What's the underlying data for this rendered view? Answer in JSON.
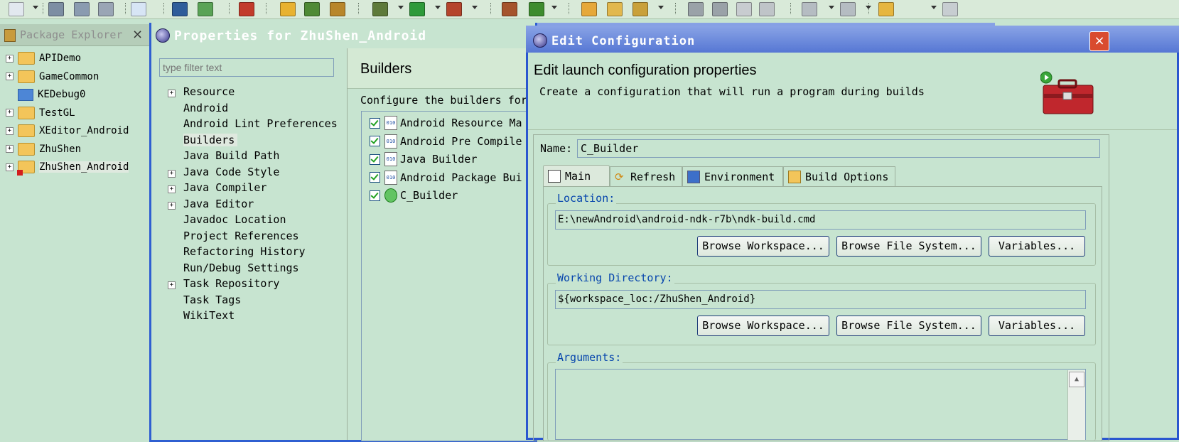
{
  "toolbar": {
    "icons": [
      "new-icon",
      "save-icon",
      "save-all-icon",
      "print-icon",
      "binary-icon",
      "download-icon",
      "android-sdk-icon",
      "task-icon",
      "open-type-icon",
      "junit-icon",
      "jar-icon",
      "debug-icon",
      "run-icon",
      "external-tools-icon",
      "build-icon",
      "refresh-icon",
      "folder-icon",
      "open-folder-icon",
      "pin-icon",
      "annotation-icon",
      "pen-icon",
      "document-icon",
      "paragraph-icon",
      "next-annotation-icon",
      "prev-annotation-icon",
      "back-icon",
      "forward-icon"
    ]
  },
  "package_explorer": {
    "title": "Package Explorer",
    "items": [
      {
        "label": "APIDemo",
        "kind": "project",
        "expandable": true
      },
      {
        "label": "GameCommon",
        "kind": "project",
        "expandable": true
      },
      {
        "label": "KEDebug0",
        "kind": "folder",
        "expandable": false
      },
      {
        "label": "TestGL",
        "kind": "project",
        "expandable": true
      },
      {
        "label": "XEditor_Android",
        "kind": "project",
        "expandable": true
      },
      {
        "label": "ZhuShen",
        "kind": "project",
        "expandable": true
      },
      {
        "label": "ZhuShen_Android",
        "kind": "project-error",
        "expandable": true
      }
    ]
  },
  "properties": {
    "title": "Properties for ZhuShen_Android",
    "filter_placeholder": "type filter text",
    "items": [
      {
        "label": "Resource",
        "expandable": true
      },
      {
        "label": "Android",
        "expandable": false
      },
      {
        "label": "Android Lint Preferences",
        "expandable": false
      },
      {
        "label": "Builders",
        "expandable": false
      },
      {
        "label": "Java Build Path",
        "expandable": false
      },
      {
        "label": "Java Code Style",
        "expandable": true
      },
      {
        "label": "Java Compiler",
        "expandable": true
      },
      {
        "label": "Java Editor",
        "expandable": true
      },
      {
        "label": "Javadoc Location",
        "expandable": false
      },
      {
        "label": "Project References",
        "expandable": false
      },
      {
        "label": "Refactoring History",
        "expandable": false
      },
      {
        "label": "Run/Debug Settings",
        "expandable": false
      },
      {
        "label": "Task Repository",
        "expandable": true
      },
      {
        "label": "Task Tags",
        "expandable": false
      },
      {
        "label": "WikiText",
        "expandable": false
      }
    ],
    "page_title": "Builders",
    "page_desc": "Configure the builders for",
    "builders": [
      {
        "label": "Android Resource Ma",
        "checked": true
      },
      {
        "label": "Android Pre Compile",
        "checked": true
      },
      {
        "label": "Java Builder",
        "checked": true
      },
      {
        "label": "Android Package Bui",
        "checked": true
      },
      {
        "label": "C_Builder",
        "checked": true
      }
    ]
  },
  "edit_config": {
    "title": "Edit Configuration",
    "close_label": "×",
    "heading": "Edit launch configuration properties",
    "subtitle": "Create a configuration that will run a program during builds",
    "name_label": "Name:",
    "name_value": "C_Builder",
    "tabs": [
      "Main",
      "Refresh",
      "Environment",
      "Build Options"
    ],
    "location_label": "Location:",
    "location_value": "E:\\newAndroid\\android-ndk-r7b\\ndk-build.cmd",
    "working_dir_label": "Working Directory:",
    "working_dir_value": "${workspace_loc:/ZhuShen_Android}",
    "arguments_label": "Arguments:",
    "btn_workspace": "Browse Workspace...",
    "btn_filesystem": "Browse File System...",
    "btn_variables": "Variables..."
  },
  "colors": {
    "titlebar": "#5677d4",
    "background": "#c7e4d0",
    "close": "#d94b2e"
  }
}
